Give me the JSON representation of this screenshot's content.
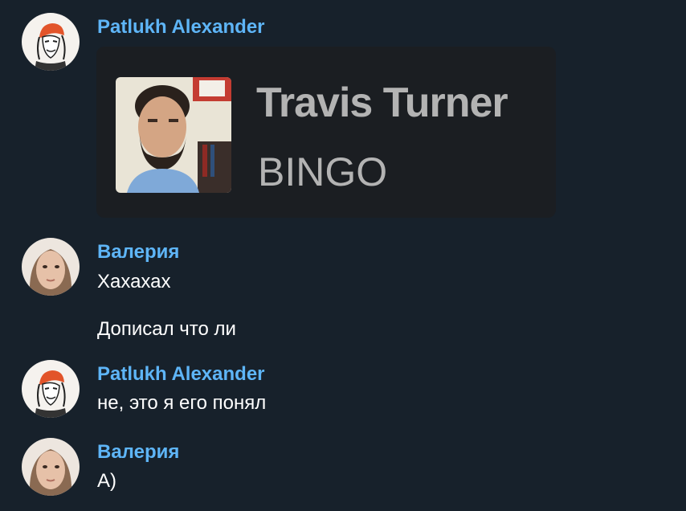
{
  "messages": [
    {
      "sender": "Patlukh Alexander",
      "avatar": "portrait-sketch-avatar",
      "card": {
        "title": "Travis Turner",
        "subtitle": "BINGO",
        "photo": "man-with-beard-photo"
      }
    },
    {
      "sender": "Валерия",
      "avatar": "woman-photo-avatar",
      "lines": [
        "Хахахах",
        "Дописал что ли"
      ]
    },
    {
      "sender": "Patlukh Alexander",
      "avatar": "portrait-sketch-avatar",
      "lines": [
        "не, это я его понял"
      ]
    },
    {
      "sender": "Валерия",
      "avatar": "woman-photo-avatar",
      "lines": [
        "А)"
      ]
    }
  ],
  "colors": {
    "background": "#17212b",
    "sender_name": "#5eb5f7",
    "message_text": "#ffffff",
    "card_background": "#1b1e22",
    "card_text": "#b3b3b3"
  }
}
